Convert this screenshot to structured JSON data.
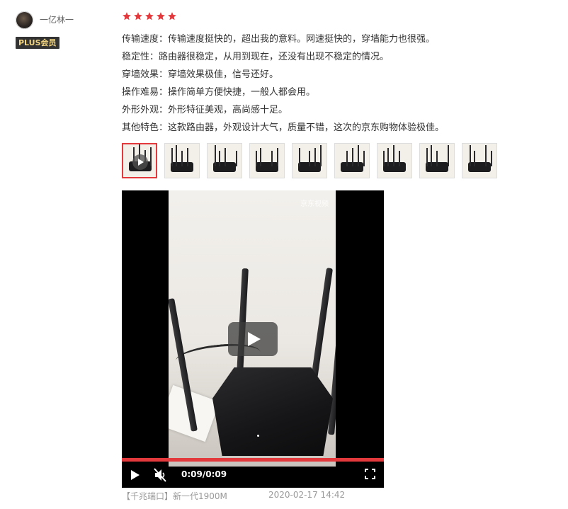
{
  "user": {
    "name": "一亿林一",
    "member_badge": "PLUS会员",
    "avatar_icon": "user-avatar"
  },
  "review": {
    "rating": 5,
    "rating_max": 5,
    "star_color": "#e4393c",
    "lines": [
      {
        "label": "传输速度",
        "text": "传输速度：传输速度挺快的，超出我的意料。网速挺快的，穿墙能力也很强。"
      },
      {
        "label": "稳定性",
        "text": "稳定性：路由器很稳定，从用到现在，还没有出现不稳定的情况。"
      },
      {
        "label": "穿墙效果",
        "text": "穿墙效果：穿墙效果极佳，信号还好。"
      },
      {
        "label": "操作难易",
        "text": "操作难易：操作简单方便快捷，一般人都会用。"
      },
      {
        "label": "外形外观",
        "text": "外形外观：外形特征美观，高尚感十足。"
      },
      {
        "label": "其他特色",
        "text": "其他特色：这款路由器，外观设计大气，质量不错，这次的京东购物体验极佳。"
      }
    ],
    "thumbnails": [
      {
        "type": "video",
        "selected": true
      },
      {
        "type": "image",
        "selected": false
      },
      {
        "type": "image",
        "selected": false
      },
      {
        "type": "image",
        "selected": false
      },
      {
        "type": "image",
        "selected": false
      },
      {
        "type": "image",
        "selected": false
      },
      {
        "type": "image",
        "selected": false
      },
      {
        "type": "image",
        "selected": false
      },
      {
        "type": "image",
        "selected": false
      }
    ],
    "product_spec": "【千兆端口】新一代1900M",
    "date": "2020-02-17 14:42"
  },
  "video_player": {
    "watermark": "京东视频",
    "time_display": "0:09/0:09",
    "progress_fraction": 1.0,
    "progress_color": "#e4393c",
    "muted": true,
    "icons": [
      "play-icon",
      "mute-icon",
      "fullscreen-icon",
      "big-play-icon"
    ]
  }
}
